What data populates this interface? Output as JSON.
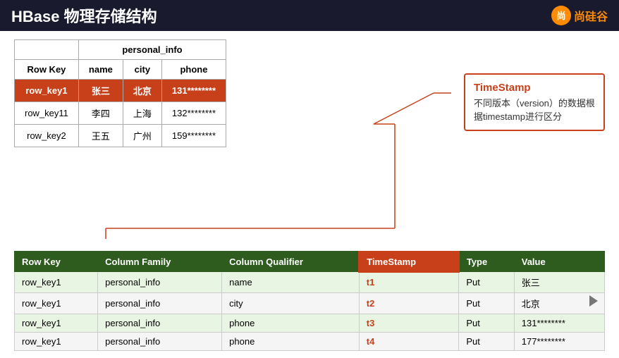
{
  "header": {
    "title": "HBase 物理存储结构",
    "logo_icon": "尚",
    "logo_text": "尚硅谷"
  },
  "timestamp_callout": {
    "title": "TimeStamp",
    "description": "不同版本（version）的数据根据timestamp进行区分"
  },
  "logical_table": {
    "personal_info_header": "personal_info",
    "columns": [
      "Row Key",
      "name",
      "city",
      "phone"
    ],
    "rows": [
      {
        "row_key": "row_key1",
        "name": "张三",
        "city": "北京",
        "phone": "131********",
        "highlighted": true
      },
      {
        "row_key": "row_key11",
        "name": "李四",
        "city": "上海",
        "phone": "132********",
        "highlighted": false
      },
      {
        "row_key": "row_key2",
        "name": "王五",
        "city": "广州",
        "phone": "159********",
        "highlighted": false
      }
    ]
  },
  "physical_table": {
    "columns": [
      "Row Key",
      "Column Family",
      "Column Qualifier",
      "TimeStamp",
      "Type",
      "Value"
    ],
    "rows": [
      {
        "row_key": "row_key1",
        "col_family": "personal_info",
        "col_qualifier": "name",
        "timestamp": "t1",
        "type": "Put",
        "value": "张三"
      },
      {
        "row_key": "row_key1",
        "col_family": "personal_info",
        "col_qualifier": "city",
        "timestamp": "t2",
        "type": "Put",
        "value": "北京"
      },
      {
        "row_key": "row_key1",
        "col_family": "personal_info",
        "col_qualifier": "phone",
        "timestamp": "t3",
        "type": "Put",
        "value": "131********"
      },
      {
        "row_key": "row_key1",
        "col_family": "personal_info",
        "col_qualifier": "phone",
        "timestamp": "t4",
        "type": "Put",
        "value": "177********"
      }
    ]
  }
}
